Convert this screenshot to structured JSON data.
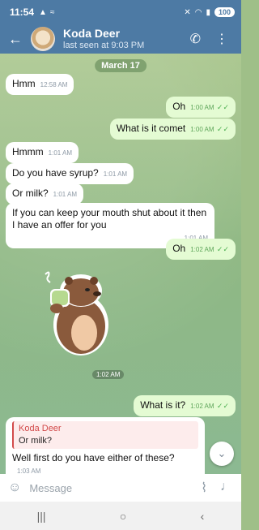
{
  "status": {
    "time": "11:54",
    "battery": "100"
  },
  "header": {
    "title": "Koda Deer",
    "subtitle": "last seen at 9:03 PM"
  },
  "chat": {
    "date": "March 17",
    "messages": [
      {
        "dir": "in",
        "text": "Hmm",
        "time": "12:58 AM"
      },
      {
        "dir": "out",
        "text": "Oh",
        "time": "1:00 AM"
      },
      {
        "dir": "out",
        "text": "What is it comet",
        "time": "1:00 AM"
      },
      {
        "dir": "in",
        "text": "Hmmm",
        "time": "1:01 AM"
      },
      {
        "dir": "in",
        "text": "Do you have syrup?",
        "time": "1:01 AM"
      },
      {
        "dir": "in",
        "text": "Or milk?",
        "time": "1:01 AM"
      },
      {
        "dir": "in",
        "text": "If you can keep your mouth shut about it then I have an offer for you",
        "time": "1:01 AM"
      },
      {
        "dir": "out",
        "text": "Oh",
        "time": "1:02 AM"
      },
      {
        "dir": "sticker",
        "time": "1:02 AM"
      },
      {
        "dir": "out",
        "text": "What is it?",
        "time": "1:02 AM"
      },
      {
        "dir": "in",
        "reply_name": "Koda Deer",
        "reply_text": "Or milk?",
        "text": "Well first do you have either of these?",
        "time": "1:03 AM"
      }
    ]
  },
  "composer": {
    "placeholder": "Message"
  }
}
